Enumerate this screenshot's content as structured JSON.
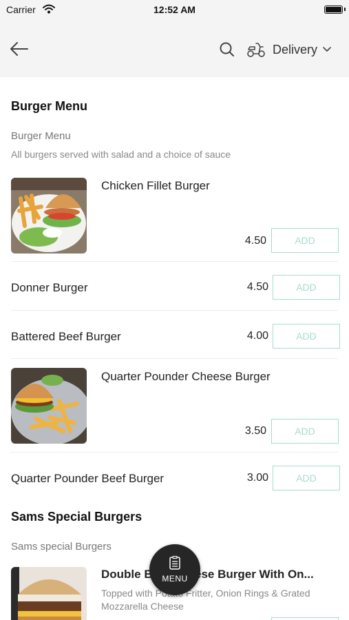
{
  "status_bar": {
    "carrier": "Carrier",
    "time": "12:52 AM"
  },
  "nav": {
    "delivery_label": "Delivery",
    "icons": [
      "back-arrow-icon",
      "search-icon",
      "scooter-icon",
      "chevron-down-icon"
    ]
  },
  "colors": {
    "header_bg": "#f4f4f4",
    "add_button_accent": "#a8dcc8",
    "fab_bg": "#262626"
  },
  "sections": [
    {
      "title": "Burger Menu",
      "subsection_title": "Burger Menu",
      "subsection_desc": "All burgers served with salad and a choice of sauce",
      "items": [
        {
          "name": "Chicken Fillet Burger",
          "price": "4.50",
          "add_label": "ADD",
          "has_image": true
        },
        {
          "name": "Donner Burger",
          "price": "4.50",
          "add_label": "ADD",
          "has_image": false
        },
        {
          "name": "Battered Beef Burger",
          "price": "4.00",
          "add_label": "ADD",
          "has_image": false
        },
        {
          "name": "Quarter Pounder Cheese Burger",
          "price": "3.50",
          "add_label": "ADD",
          "has_image": true
        },
        {
          "name": "Quarter Pounder Beef Burger",
          "price": "3.00",
          "add_label": "ADD",
          "has_image": false
        }
      ]
    },
    {
      "title": "Sams Special Burgers",
      "subsection_title": "Sams special Burgers",
      "items": [
        {
          "name": "Double Beef Cheese Burger With On...",
          "desc": "Topped with Potato Fritter, Onion Rings & Grated Mozzarella Cheese",
          "has_image": true
        }
      ]
    }
  ],
  "menu_button": {
    "label": "MENU"
  }
}
